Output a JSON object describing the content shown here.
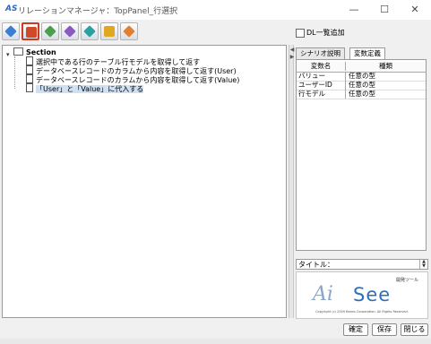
{
  "window": {
    "app_icon_text": "AS",
    "title": "リレーションマネージャ：TopPanel_行選択",
    "minimize_icon": "minimize-icon",
    "maximize_icon": "maximize-icon",
    "close_icon": "close-icon"
  },
  "toolbar": {
    "buttons": [
      {
        "icon": "diamond-blue-icon",
        "color": "#3a7fd0",
        "active": false
      },
      {
        "icon": "document-red-icon",
        "color": "#d04a2a",
        "active": true
      },
      {
        "icon": "diamond-green-icon",
        "color": "#4aa04a",
        "active": false
      },
      {
        "icon": "diamond-purple-icon",
        "color": "#8a5ac0",
        "active": false
      },
      {
        "icon": "diamond-teal-icon",
        "color": "#2aa0a0",
        "active": false
      },
      {
        "icon": "document-yellow-icon",
        "color": "#e0a820",
        "active": false
      },
      {
        "icon": "diamond-orange-icon",
        "color": "#e08030",
        "active": false
      }
    ]
  },
  "dl_checkbox": {
    "label": "DL一覧追加",
    "checked": false
  },
  "tree": {
    "root": {
      "label": "Section"
    },
    "items": [
      {
        "label": "選択中である行のテーブル行モデルを取得して返す",
        "selected": false
      },
      {
        "label": "データベースレコードのカラムから内容を取得して返す(User)",
        "selected": false
      },
      {
        "label": "データベースレコードのカラムから内容を取得して返す(Value)",
        "selected": false
      },
      {
        "label": "「User」と「Value」に代入する",
        "selected": true
      }
    ]
  },
  "tabs": [
    {
      "label": "シナリオ説明",
      "active": false
    },
    {
      "label": "変数定義",
      "active": true
    }
  ],
  "variables_table": {
    "headers": [
      "変数名",
      "種類"
    ],
    "rows": [
      [
        "バリュー",
        "任意の型"
      ],
      [
        "ユーザーID",
        "任意の型"
      ],
      [
        "行モデル",
        "任意の型"
      ]
    ]
  },
  "title_field": {
    "label": "タイトル：",
    "value": ""
  },
  "logo": {
    "tagline": "開発ツール",
    "ai_text": "Ai",
    "see_text": "See",
    "copyright": "Copyright (c) 2009 Beans Corporation. All Rights Reserved."
  },
  "footer_buttons": {
    "ok": "確定",
    "save": "保存",
    "close": "閉じる"
  },
  "colors": {
    "accent": "#2f6fba",
    "selection": "#cfe0f2",
    "active_border": "#d03a20"
  }
}
